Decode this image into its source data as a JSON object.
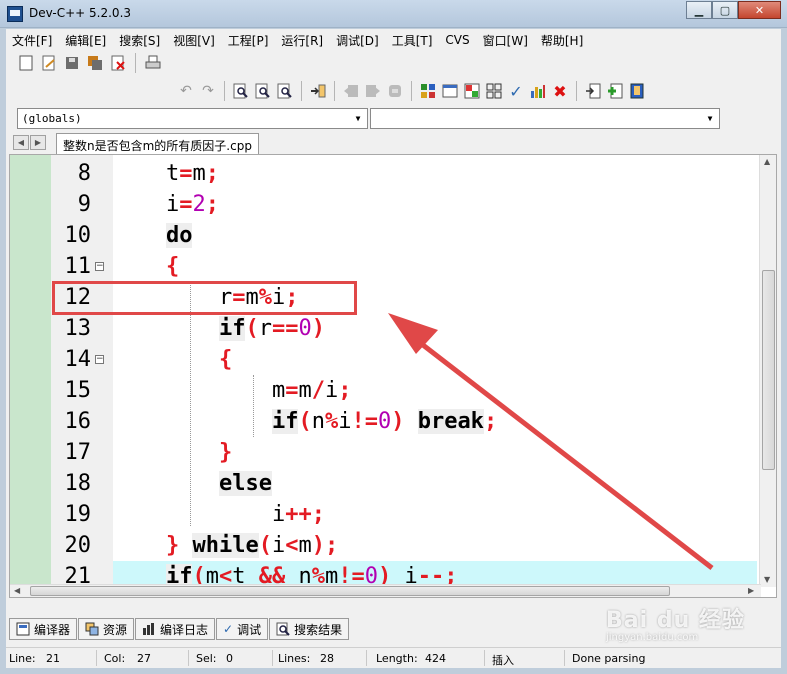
{
  "window": {
    "title": "Dev-C++ 5.2.0.3"
  },
  "menu": [
    "文件[F]",
    "编辑[E]",
    "搜索[S]",
    "视图[V]",
    "工程[P]",
    "运行[R]",
    "调试[D]",
    "工具[T]",
    "CVS",
    "窗口[W]",
    "帮助[H]"
  ],
  "combos": {
    "scope": "(globals)",
    "symbol": ""
  },
  "file_tab": {
    "name": "整数n是否包含m的所有质因子.cpp"
  },
  "editor": {
    "line_numbers": [
      "8",
      "9",
      "10",
      "11",
      "12",
      "13",
      "14",
      "15",
      "16",
      "17",
      "18",
      "19",
      "20",
      "21"
    ],
    "current_line": "21"
  },
  "bottom_tabs": [
    "编译器",
    "资源",
    "编译日志",
    "调试",
    "搜索结果"
  ],
  "status": {
    "line_label": "Line:",
    "line_value": "21",
    "col_label": "Col:",
    "col_value": "27",
    "sel_label": "Sel:",
    "sel_value": "0",
    "lines_label": "Lines:",
    "lines_value": "28",
    "length_label": "Length:",
    "length_value": "424",
    "mode": "插入",
    "message": "Done parsing"
  },
  "watermark": {
    "brand": "Bai du 经验",
    "url": "jingyan.baidu.com"
  },
  "colors": {
    "annotation": "#e04848",
    "highlight_line": "#cdf8fb",
    "gutter": "#c9e6cc"
  }
}
